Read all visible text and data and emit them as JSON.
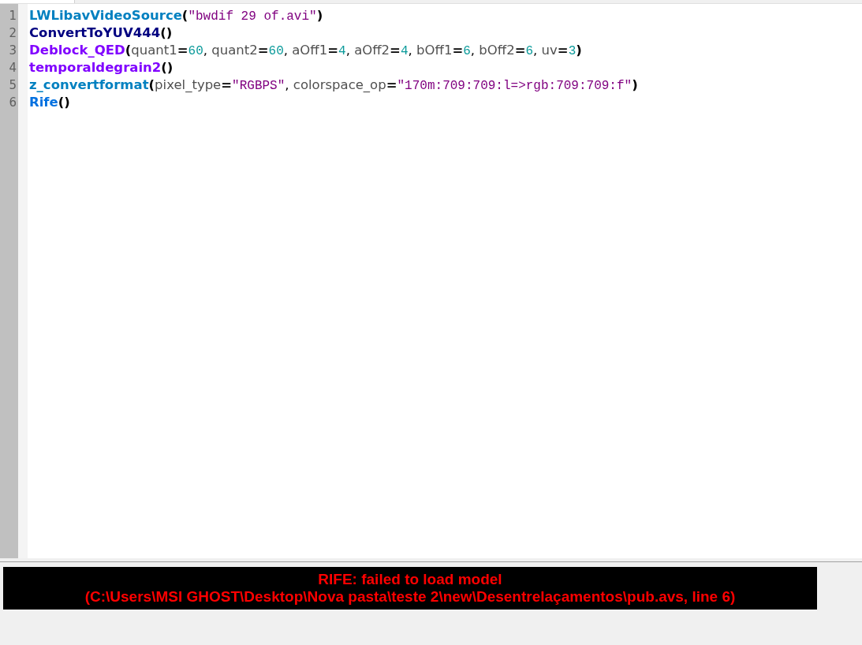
{
  "editor": {
    "lines": [
      {
        "number": "1",
        "tokens": [
          {
            "kind": "func",
            "color": "#0080c0",
            "text": "LWLibavVideoSource"
          },
          {
            "kind": "paren",
            "text": "("
          },
          {
            "kind": "string",
            "text": "\"bwdif 29 of.avi\""
          },
          {
            "kind": "paren",
            "text": ")"
          }
        ]
      },
      {
        "number": "2",
        "tokens": [
          {
            "kind": "func",
            "color": "#000080",
            "text": "ConvertToYUV444"
          },
          {
            "kind": "paren",
            "text": "()"
          }
        ]
      },
      {
        "number": "3",
        "tokens": [
          {
            "kind": "func",
            "color": "#8000ff",
            "text": "Deblock_QED"
          },
          {
            "kind": "paren",
            "text": "("
          },
          {
            "kind": "param",
            "text": "quant1"
          },
          {
            "kind": "op",
            "text": "="
          },
          {
            "kind": "number",
            "text": "60"
          },
          {
            "kind": "punct",
            "text": ", "
          },
          {
            "kind": "param",
            "text": "quant2"
          },
          {
            "kind": "op",
            "text": "="
          },
          {
            "kind": "number",
            "text": "60"
          },
          {
            "kind": "punct",
            "text": ", "
          },
          {
            "kind": "param",
            "text": "aOff1"
          },
          {
            "kind": "op",
            "text": "="
          },
          {
            "kind": "number",
            "text": "4"
          },
          {
            "kind": "punct",
            "text": ", "
          },
          {
            "kind": "param",
            "text": "aOff2"
          },
          {
            "kind": "op",
            "text": "="
          },
          {
            "kind": "number",
            "text": "4"
          },
          {
            "kind": "punct",
            "text": ", "
          },
          {
            "kind": "param",
            "text": "bOff1"
          },
          {
            "kind": "op",
            "text": "="
          },
          {
            "kind": "number",
            "text": "6"
          },
          {
            "kind": "punct",
            "text": ", "
          },
          {
            "kind": "param",
            "text": "bOff2"
          },
          {
            "kind": "op",
            "text": "="
          },
          {
            "kind": "number",
            "text": "6"
          },
          {
            "kind": "punct",
            "text": ", "
          },
          {
            "kind": "param",
            "text": "uv"
          },
          {
            "kind": "op",
            "text": "="
          },
          {
            "kind": "number",
            "text": "3"
          },
          {
            "kind": "paren",
            "text": ")"
          }
        ]
      },
      {
        "number": "4",
        "tokens": [
          {
            "kind": "func",
            "color": "#8000ff",
            "text": "temporaldegrain2"
          },
          {
            "kind": "paren",
            "text": "()"
          }
        ]
      },
      {
        "number": "5",
        "tokens": [
          {
            "kind": "func",
            "color": "#0080c0",
            "text": "z_convertformat"
          },
          {
            "kind": "paren",
            "text": "("
          },
          {
            "kind": "param",
            "text": "pixel_type"
          },
          {
            "kind": "op",
            "text": "="
          },
          {
            "kind": "string",
            "text": "\"RGBPS\""
          },
          {
            "kind": "punct",
            "text": ", "
          },
          {
            "kind": "param",
            "text": "colorspace_op"
          },
          {
            "kind": "op",
            "text": "="
          },
          {
            "kind": "string",
            "text": "\"170m:709:709:l=>rgb:709:709:f\""
          },
          {
            "kind": "paren",
            "text": ")"
          }
        ]
      },
      {
        "number": "6",
        "tokens": [
          {
            "kind": "func",
            "color": "#0070e0",
            "text": "Rife"
          },
          {
            "kind": "paren",
            "text": "()"
          }
        ]
      }
    ]
  },
  "error_panel": {
    "lines": [
      "RIFE: failed to load model",
      "(C:\\Users\\MSI GHOST\\Desktop\\Nova pasta\\teste 2\\new\\Desentrelaçamentos\\pub.avs, line 6)"
    ]
  }
}
